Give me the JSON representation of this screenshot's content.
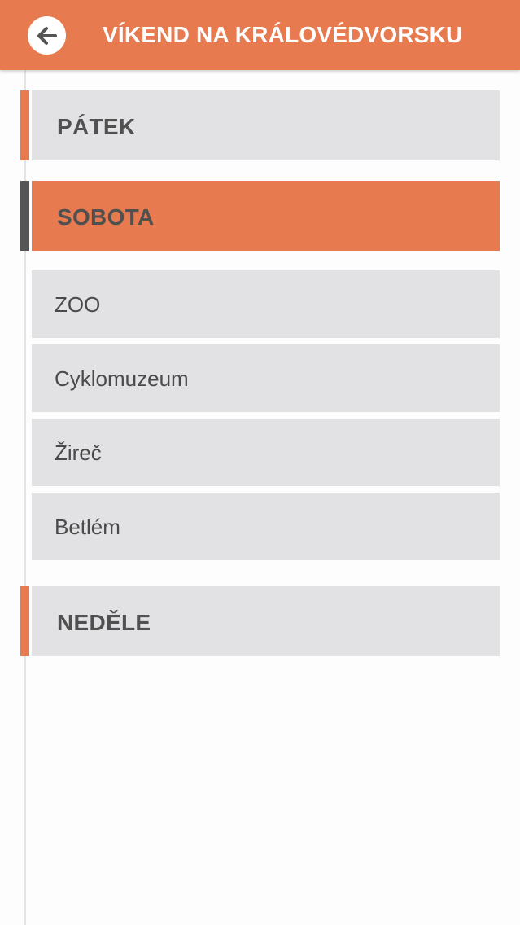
{
  "header": {
    "title": "VÍKEND NA KRÁLOVÉDVORSKU",
    "back_icon": "arrow-left-icon",
    "background_color": "#e87a4f"
  },
  "days": [
    {
      "label": "PÁTEK",
      "marker_color": "#e87a4f",
      "expanded": false
    },
    {
      "label": "SOBOTA",
      "marker_color": "#555555",
      "expanded": true,
      "items": [
        {
          "label": "ZOO"
        },
        {
          "label": "Cyklomuzeum"
        },
        {
          "label": "Žireč"
        },
        {
          "label": "Betlém"
        }
      ]
    },
    {
      "label": "NEDĚLE",
      "marker_color": "#e87a4f",
      "expanded": false
    }
  ],
  "colors": {
    "accent": "#e87a4f",
    "card_background": "#e2e1e3",
    "text": "#505050"
  }
}
